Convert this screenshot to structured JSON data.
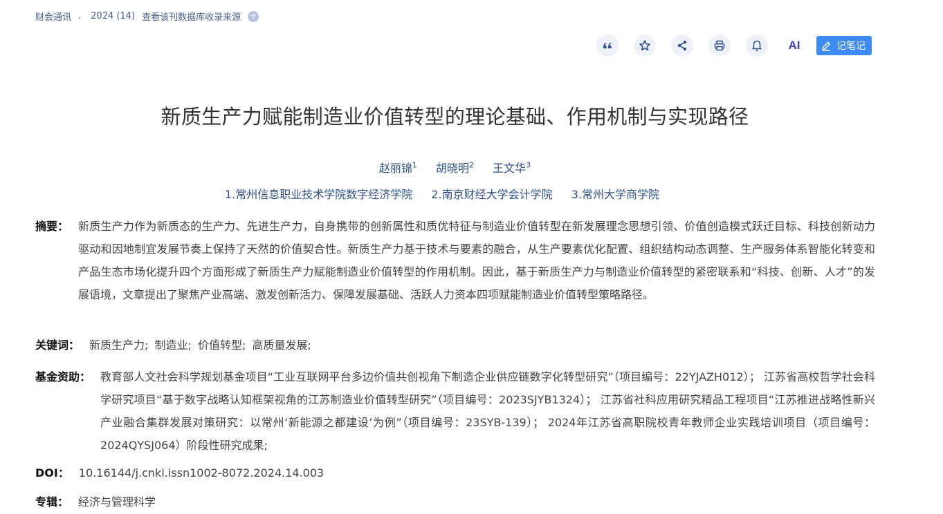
{
  "source": {
    "journal": "财会通讯",
    "dot": ".",
    "issue": "2024 (14)",
    "db_link": "查看该刊数据库收录来源"
  },
  "toolbar": {
    "quote_icon": "quote-icon",
    "favorite_icon": "star-icon",
    "share_icon": "share-icon",
    "print_icon": "print-icon",
    "alert_icon": "bell-icon",
    "ai_label": "AI",
    "note_label": "记笔记"
  },
  "article": {
    "title": "新质生产力赋能制造业价值转型的理论基础、作用机制与实现路径",
    "authors": [
      {
        "name": "赵丽锦",
        "sup": "1"
      },
      {
        "name": "胡晓明",
        "sup": "2"
      },
      {
        "name": "王文华",
        "sup": "3"
      }
    ],
    "affiliations": [
      "1.常州信息职业技术学院数字经济学院",
      "2.南京财经大学会计学院",
      "3.常州大学商学院"
    ],
    "abstract_label": "摘要：",
    "abstract": "新质生产力作为新质态的生产力、先进生产力，自身携带的创新属性和质优特征与制造业价值转型在新发展理念思想引领、价值创造模式跃迁目标、科技创新动力驱动和因地制宜发展节奏上保持了天然的价值契合性。新质生产力基于技术与要素的融合，从生产要素优化配置、组织结构动态调整、生产服务体系智能化转变和产品生态市场化提升四个方面形成了新质生产力赋能制造业价值转型的作用机制。因此，基于新质生产力与制造业价值转型的紧密联系和“科技、创新、人才”的发展语境，文章提出了聚焦产业高端、激发创新活力、保障发展基础、活跃人力资本四项赋能制造业价值转型策略路径。",
    "keywords_label": "关键词：",
    "keywords": [
      "新质生产力;",
      "制造业;",
      "价值转型;",
      "高质量发展;"
    ],
    "funds_label": "基金资助：",
    "funds": "教育部人文社会科学规划基金项目“工业互联网平台多边价值共创视角下制造企业供应链数字化转型研究”（项目编号：22YJAZH012）； 江苏省高校哲学社会科学研究项目“基于数字战略认知框架视角的江苏制造业价值转型研究”（项目编号：2023SJYB1324）； 江苏省社科应用研究精品工程项目“江苏推进战略性新兴产业融合集群发展对策研究：以常州‘新能源之都建设’为例”（项目编号：23SYB-139）； 2024年江苏省高职院校青年教师企业实践培训项目（项目编号：2024QYSJ064）阶段性研究成果;",
    "doi_label": "DOI：",
    "doi": "10.16144/j.cnki.issn1002-8072.2024.14.003",
    "album_label": "专辑：",
    "album": "经济与管理科学"
  }
}
